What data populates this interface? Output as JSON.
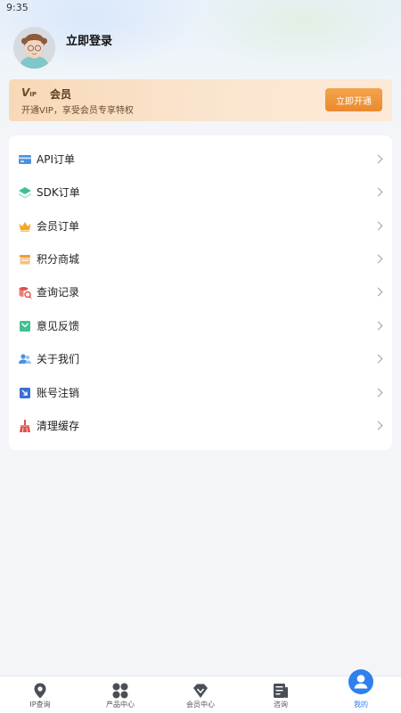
{
  "status_bar": {
    "time": "9:35"
  },
  "profile": {
    "login_label": "立即登录"
  },
  "vip": {
    "logo_big": "V",
    "logo_small": "IP",
    "title": "会员",
    "subtitle": "开通VIP，享受会员专享特权",
    "button_label": "立即开通"
  },
  "menu": {
    "items": [
      {
        "label": "API订单",
        "icon": "card-icon"
      },
      {
        "label": "SDK订单",
        "icon": "layers-icon"
      },
      {
        "label": "会员订单",
        "icon": "crown-icon"
      },
      {
        "label": "积分商城",
        "icon": "store-icon"
      },
      {
        "label": "查询记录",
        "icon": "search-record-icon"
      },
      {
        "label": "意见反馈",
        "icon": "feedback-icon"
      },
      {
        "label": "关于我们",
        "icon": "users-icon"
      },
      {
        "label": "账号注销",
        "icon": "logout-icon"
      },
      {
        "label": "清理缓存",
        "icon": "broom-icon"
      }
    ]
  },
  "tabbar": {
    "tabs": [
      {
        "label": "IP查询",
        "icon": "location-pin-icon"
      },
      {
        "label": "产品中心",
        "icon": "grid-icon"
      },
      {
        "label": "会员中心",
        "icon": "diamond-icon"
      },
      {
        "label": "咨询",
        "icon": "news-icon"
      },
      {
        "label": "我的",
        "icon": "user-icon"
      }
    ],
    "active_index": 4
  },
  "colors": {
    "accent": "#2f80ed",
    "vip_button": "#ea8a2e"
  }
}
